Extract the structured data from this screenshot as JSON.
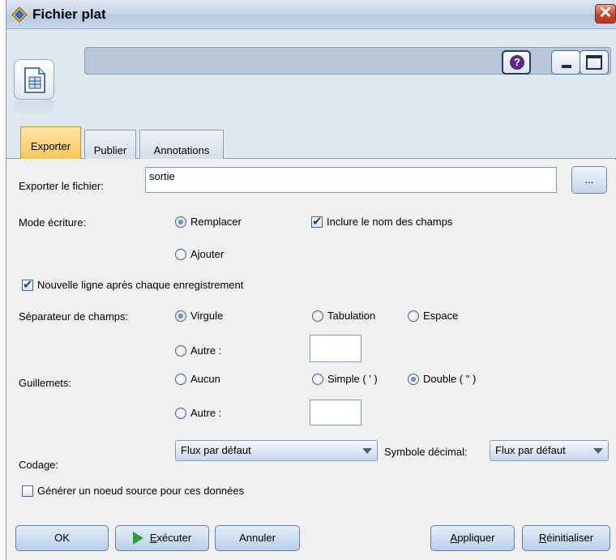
{
  "window": {
    "title": "Fichier plat",
    "close_label": "✕"
  },
  "header": {
    "help_label": "?"
  },
  "tabs": [
    {
      "label": "Exporter",
      "active": true
    },
    {
      "label": "Publier",
      "active": false
    },
    {
      "label": "Annotations",
      "active": false
    }
  ],
  "export": {
    "file_label": "Exporter le fichier:",
    "file_value": "sortie",
    "browse_label": "..."
  },
  "write_mode": {
    "label": "Mode écriture:",
    "options": [
      {
        "label": "Remplacer",
        "selected": true
      },
      {
        "label": "Ajouter",
        "selected": false
      }
    ],
    "include_names_label": "Inclure le nom des champs",
    "include_names_checked": true
  },
  "newline": {
    "label": "Nouvelle ligne après chaque enregistrement",
    "checked": true
  },
  "separator": {
    "label": "Séparateur de champs:",
    "options": [
      {
        "label": "Virgule",
        "selected": true
      },
      {
        "label": "Tabulation",
        "selected": false
      },
      {
        "label": "Espace",
        "selected": false
      },
      {
        "label": "Autre :",
        "selected": false
      }
    ],
    "other_value": ""
  },
  "quotes": {
    "label": "Guillemets:",
    "options": [
      {
        "label": "Aucun",
        "selected": false
      },
      {
        "label": "Simple ( ' )",
        "selected": false
      },
      {
        "label": "Double ( \" )",
        "selected": true
      },
      {
        "label": "Autre :",
        "selected": false
      }
    ],
    "other_value": ""
  },
  "encoding": {
    "label": "Codage:",
    "value": "Flux par défaut"
  },
  "decimal": {
    "label": "Symbole décimal:",
    "value": "Flux par défaut"
  },
  "generate_source": {
    "label": "Générer un noeud source pour ces données",
    "checked": false
  },
  "buttons": {
    "ok": "OK",
    "execute_first": "E",
    "execute_rest": "xécuter",
    "cancel": "Annuler",
    "apply_first": "A",
    "apply_rest": "ppliquer",
    "reset_first": "R",
    "reset_rest": "éinitialiser"
  },
  "colors": {
    "title_bar": "#c5d4e8",
    "active_tab": "#f9c65a",
    "execute_icon": "#2f9a3c",
    "close_button": "#c9462b"
  }
}
